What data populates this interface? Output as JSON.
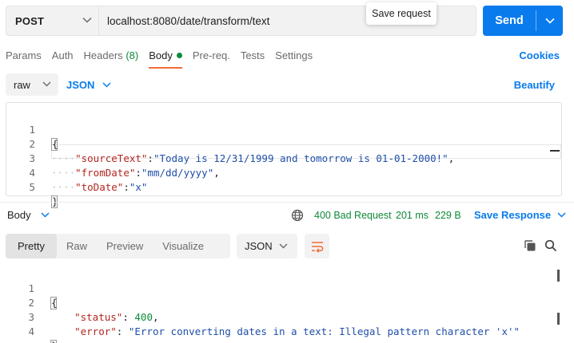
{
  "request": {
    "method": "POST",
    "url": "localhost:8080/date/transform/text",
    "tooltip": "Save request",
    "send_label": "Send"
  },
  "request_tabs": [
    {
      "label": "Params"
    },
    {
      "label": "Auth"
    },
    {
      "label": "Headers",
      "count": "(8)"
    },
    {
      "label": "Body",
      "active": true
    },
    {
      "label": "Pre-req."
    },
    {
      "label": "Tests"
    },
    {
      "label": "Settings"
    }
  ],
  "cookies_label": "Cookies",
  "body_options": {
    "mode": "raw",
    "language": "JSON",
    "beautify_label": "Beautify"
  },
  "request_body": {
    "line_numbers": [
      "1",
      "2",
      "3",
      "4",
      "5"
    ],
    "open_brace": "{",
    "close_brace": "}",
    "fields": [
      {
        "key": "\"sourceText\"",
        "value": "\"Today is 12/31/1999 and tomorrow is 01-01-2000!\"",
        "trail": ","
      },
      {
        "key": "\"fromDate\"",
        "value": "\"mm/dd/yyyy\"",
        "trail": ","
      },
      {
        "key": "\"toDate\"",
        "value": "\"x\"",
        "trail": ""
      }
    ]
  },
  "response": {
    "section_label": "Body",
    "status": "400 Bad Request",
    "time": "201 ms",
    "size": "229 B",
    "save_label": "Save Response",
    "tabs": [
      "Pretty",
      "Raw",
      "Preview",
      "Visualize"
    ],
    "active_tab": "Pretty",
    "format": "JSON",
    "line_numbers": [
      "1",
      "2",
      "3",
      "4"
    ],
    "status_key": "\"status\"",
    "status_value": "400",
    "error_key": "\"error\"",
    "error_value": "\"Error converting dates in a text: Illegal pattern character 'x'\""
  },
  "colors": {
    "accent": "#097bed",
    "success": "#0f8a3a",
    "tab_indicator": "#f26b3a",
    "json_key": "#b3261e",
    "json_string": "#1f4fa8"
  }
}
